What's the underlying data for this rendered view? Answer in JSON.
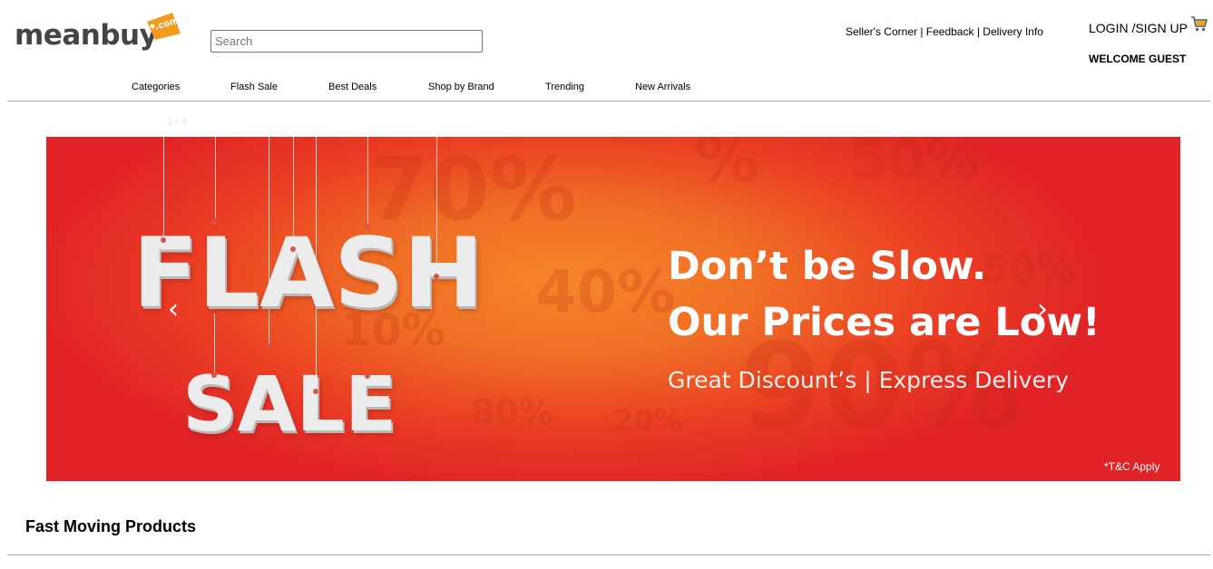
{
  "logo": {
    "word": "meanbuy",
    "tag": ".com",
    "tag_color": "#f39a21"
  },
  "search": {
    "placeholder": "Search",
    "value": ""
  },
  "top_links": [
    {
      "label": "Seller's Corner"
    },
    {
      "label": "Feedback"
    },
    {
      "label": "Delivery Info"
    }
  ],
  "top_links_separator": " | ",
  "account": {
    "login_label": "LOGIN /SIGN UP",
    "welcome_text": "WELCOME GUEST",
    "cart_icon": "cart-icon"
  },
  "nav": [
    {
      "label": "Categories"
    },
    {
      "label": "Flash Sale"
    },
    {
      "label": "Best Deals"
    },
    {
      "label": "Shop by Brand"
    },
    {
      "label": "Trending"
    },
    {
      "label": "New Arrivals"
    }
  ],
  "carousel": {
    "counter": "1 / 4",
    "prev_icon": "chevron-left-icon",
    "next_icon": "chevron-right-icon",
    "banner": {
      "word1": "FLASH",
      "word2": "SALE",
      "headline1": "Don’t be Slow.",
      "headline2": "Our Prices are Low!",
      "subline": "Great Discount’s | Express Delivery",
      "note": "*T&C Apply",
      "bg_percents": [
        "70%",
        "50%",
        "%",
        "40%",
        "10%",
        "80%",
        "20%",
        "90%",
        "50%"
      ],
      "colors": {
        "red": "#e12226",
        "orange": "#f5862a"
      }
    }
  },
  "section": {
    "title": "Fast Moving Products"
  }
}
